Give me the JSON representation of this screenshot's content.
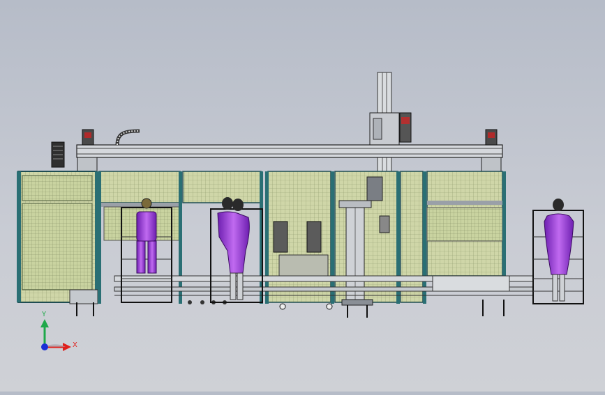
{
  "viewport": {
    "background_top": "#b6bcc8",
    "background_bottom": "#cfd1d6"
  },
  "triad": {
    "x_label": "X",
    "y_label": "Y",
    "x_color": "#e0201c",
    "y_color": "#1fa84a",
    "z_color": "#1c2fd6"
  },
  "colors": {
    "frame_teal": "#2a6f74",
    "mesh": "#c7d2a0",
    "steel": "#9aa0a8",
    "dark": "#2b2b2b",
    "mannequin": "#8a2fc8",
    "mannequin_light": "#c06af0"
  }
}
